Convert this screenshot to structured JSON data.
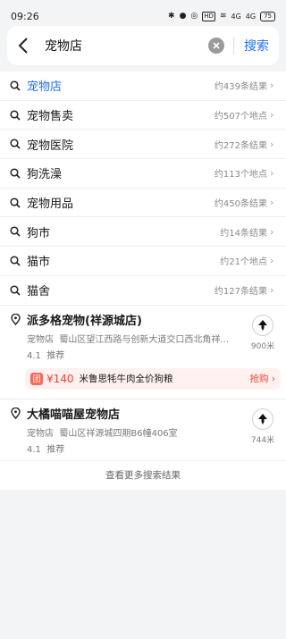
{
  "status": {
    "time": "09:26",
    "battery": "75",
    "hd": "HD",
    "signal1": "4G",
    "signal2": "4G"
  },
  "search": {
    "query": "宠物店",
    "button": "搜索"
  },
  "suggestions": [
    {
      "name": "宠物店",
      "meta": "约439条结果"
    },
    {
      "name": "宠物售卖",
      "meta": "约507个地点"
    },
    {
      "name": "宠物医院",
      "meta": "约272条结果"
    },
    {
      "name": "狗洗澡",
      "meta": "约113个地点"
    },
    {
      "name": "宠物用品",
      "meta": "约450条结果"
    },
    {
      "name": "狗市",
      "meta": "约14条结果"
    },
    {
      "name": "猫市",
      "meta": "约21个地点"
    },
    {
      "name": "猫舍",
      "meta": "约127条结果"
    }
  ],
  "pois": [
    {
      "title": "派多格宠物(祥源城店)",
      "category": "宠物店",
      "address": "蜀山区望江西路与创新大道交口西北角祥...",
      "rating": "4.1",
      "tag": "推荐",
      "distance": "900米",
      "promo": {
        "badge": "团",
        "price": "¥140",
        "text": "米鲁思牦牛肉全价狗粮",
        "action": "抢购"
      }
    },
    {
      "title": "大橘喵喵屋宠物店",
      "category": "宠物店",
      "address": "蜀山区祥源城四期B6幢406室",
      "rating": "4.1",
      "tag": "推荐",
      "distance": "744米"
    }
  ],
  "more": "查看更多搜索结果",
  "colors": {
    "accent": "#1e6ff2",
    "promo_red": "#f04535",
    "background": "#f3f4f6"
  }
}
